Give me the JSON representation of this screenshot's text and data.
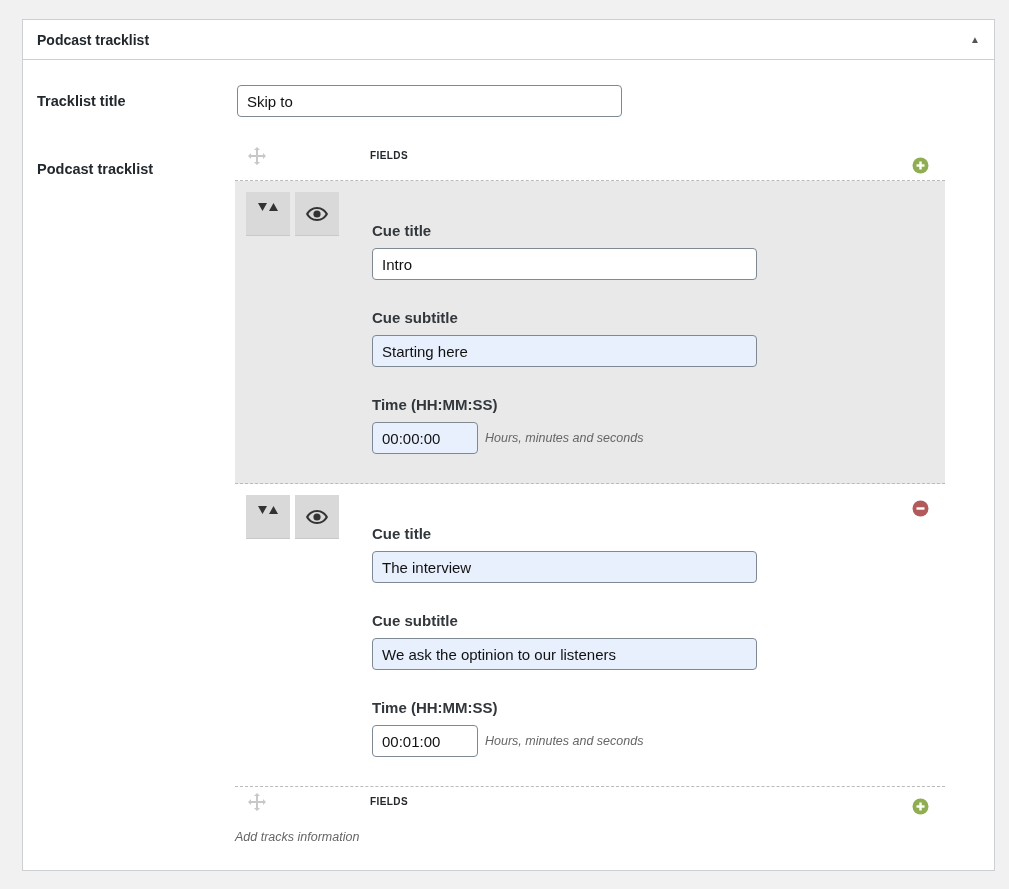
{
  "panel": {
    "title": "Podcast tracklist",
    "collapse_icon": "▲"
  },
  "tracklist_title": {
    "label": "Tracklist title",
    "value": "Skip to"
  },
  "tracklist": {
    "label": "Podcast tracklist",
    "header": "FIELDS",
    "footer_header": "FIELDS",
    "description": "Add tracks information",
    "rows": [
      {
        "highlighted": true,
        "removable": false,
        "fields": [
          {
            "kind": "text",
            "label": "Cue title",
            "value": "Intro",
            "autofilled": false
          },
          {
            "kind": "text",
            "label": "Cue subtitle",
            "value": "Starting here",
            "autofilled": true
          },
          {
            "kind": "time",
            "label": "Time (HH:MM:SS)",
            "value": "00:00:00",
            "autofilled": true,
            "hint": "Hours, minutes and seconds"
          }
        ]
      },
      {
        "highlighted": false,
        "removable": true,
        "fields": [
          {
            "kind": "text",
            "label": "Cue title",
            "value": "The interview",
            "autofilled": true
          },
          {
            "kind": "text",
            "label": "Cue subtitle",
            "value": "We ask the optinion to our listeners",
            "autofilled": true
          },
          {
            "kind": "time",
            "label": "Time (HH:MM:SS)",
            "value": "00:01:00",
            "autofilled": false,
            "hint": "Hours, minutes and seconds"
          }
        ]
      }
    ]
  }
}
